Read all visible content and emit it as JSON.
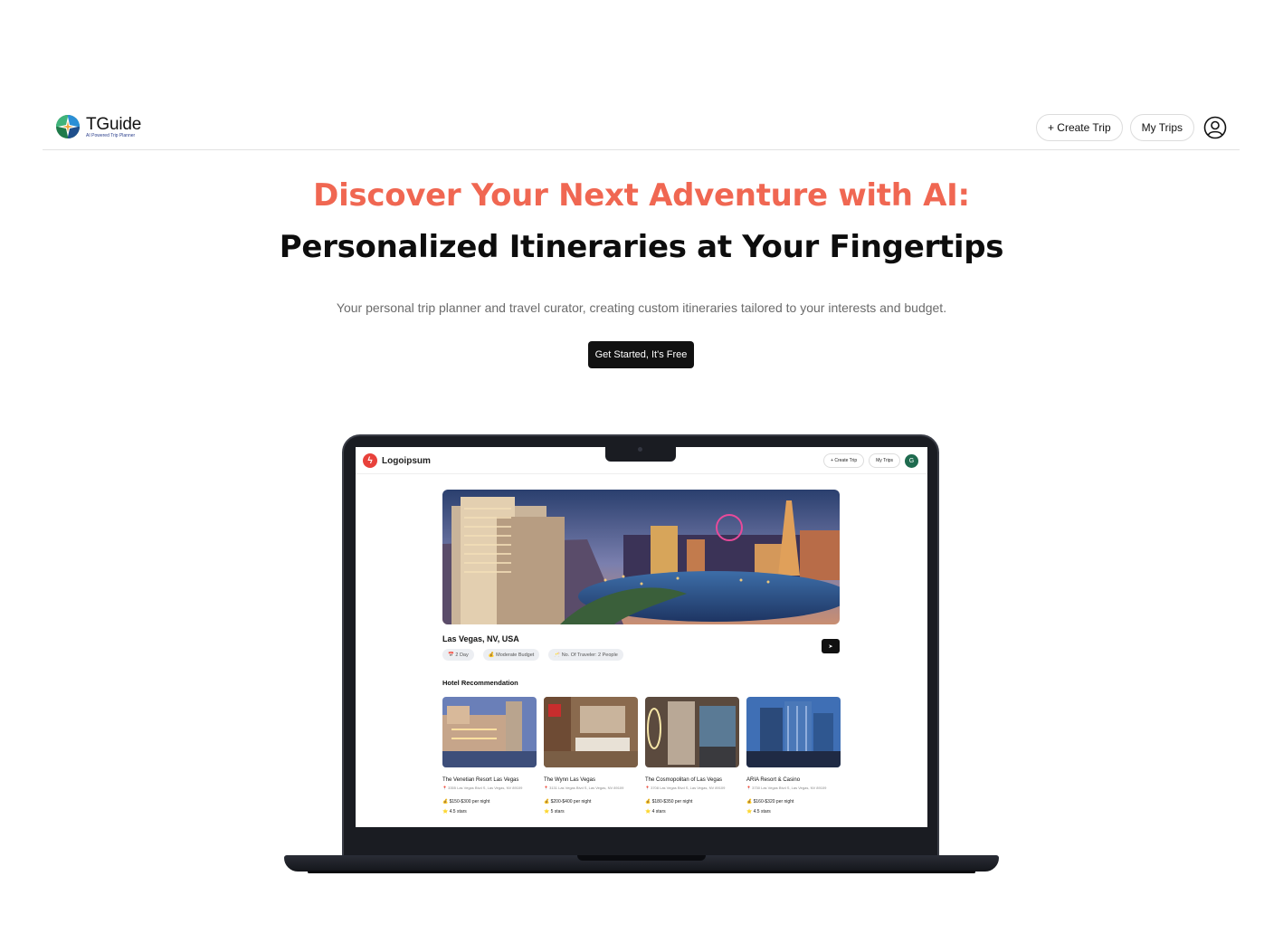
{
  "brand": {
    "name": "TGuide",
    "tagline": "AI Powered Trip Planner"
  },
  "nav": {
    "create_trip": "+ Create Trip",
    "my_trips": "My Trips",
    "user_icon": "user-circle-icon"
  },
  "hero": {
    "headline_line1": "Discover Your Next Adventure with AI:",
    "headline_line2": "Personalized Itineraries at Your Fingertips",
    "subtitle": "Your personal trip planner and travel curator, creating custom itineraries tailored to your interests and budget.",
    "cta_label": "Get Started, It's Free",
    "headline_color": "#f06752"
  },
  "preview": {
    "brand": "Logoipsum",
    "nav": {
      "create_trip": "+ Create Trip",
      "my_trips": "My Trips",
      "avatar_initial": "G"
    },
    "trip": {
      "location": "Las Vegas, NV, USA",
      "chips": [
        "📅 2 Day",
        "💰 Moderate Budget",
        "🥂 No. Of Traveler: 2 People"
      ]
    },
    "hotel_section_title": "Hotel Recommendation",
    "hotels": [
      {
        "name": "The Venetian Resort Las Vegas",
        "address": "📍 3355 Las Vegas Blvd S, Las Vegas, NV 89109",
        "price": "💰 $150-$300 per night",
        "rating": "⭐ 4.5 stars"
      },
      {
        "name": "The Wynn Las Vegas",
        "address": "📍 3131 Las Vegas Blvd S, Las Vegas, NV 89109",
        "price": "💰 $200-$400 per night",
        "rating": "⭐ 5 stars"
      },
      {
        "name": "The Cosmopolitan of Las Vegas",
        "address": "📍 3708 Las Vegas Blvd S, Las Vegas, NV 89109",
        "price": "💰 $180-$350 per night",
        "rating": "⭐ 4 stars"
      },
      {
        "name": "ARIA Resort & Casino",
        "address": "📍 3730 Las Vegas Blvd S, Las Vegas, NV 89109",
        "price": "💰 $160-$320 per night",
        "rating": "⭐ 4.5 stars"
      }
    ]
  }
}
